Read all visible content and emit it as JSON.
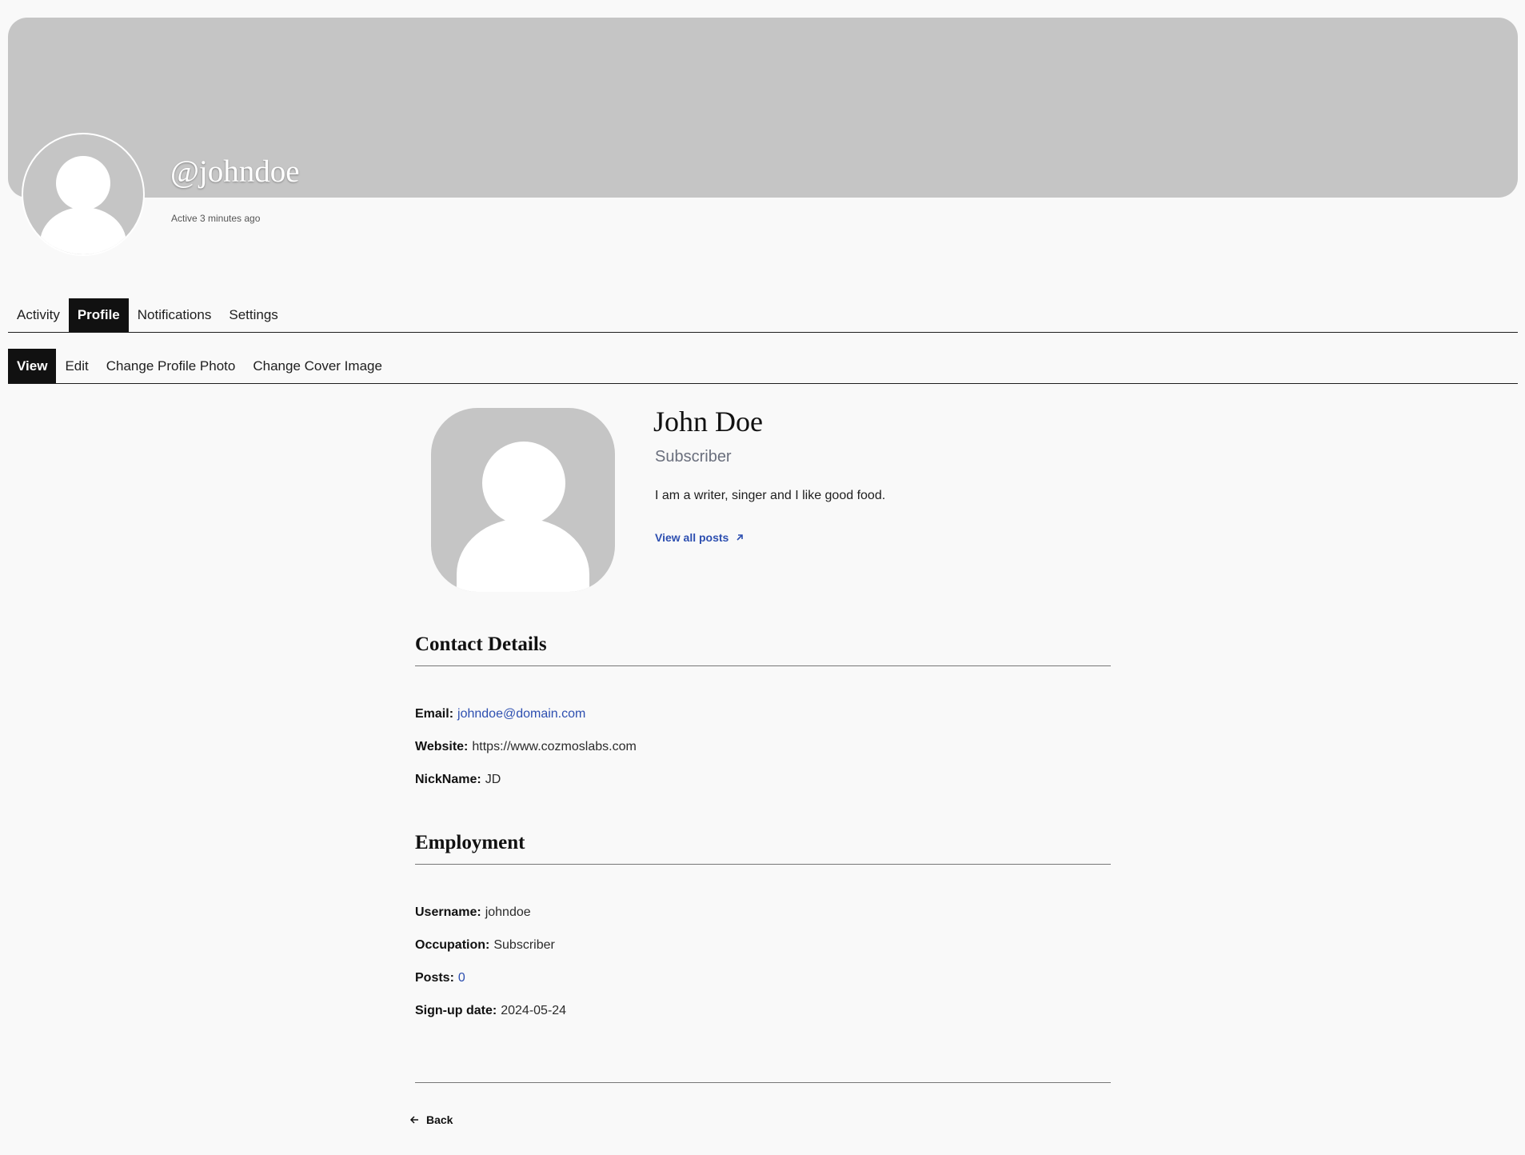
{
  "header": {
    "username": "@johndoe",
    "active_status": "Active 3 minutes ago"
  },
  "tabs": [
    {
      "label": "Activity",
      "active": false
    },
    {
      "label": "Profile",
      "active": true
    },
    {
      "label": "Notifications",
      "active": false
    },
    {
      "label": "Settings",
      "active": false
    }
  ],
  "subtabs": [
    {
      "label": "View",
      "active": true
    },
    {
      "label": "Edit",
      "active": false
    },
    {
      "label": "Change Profile Photo",
      "active": false
    },
    {
      "label": "Change Cover Image",
      "active": false
    }
  ],
  "profile": {
    "display_name": "John Doe",
    "role": "Subscriber",
    "bio": "I am a writer, singer and I like good food.",
    "view_posts_label": "View all posts"
  },
  "contact": {
    "title": "Contact Details",
    "email_label": "Email:",
    "email_value": "johndoe@domain.com",
    "website_label": "Website:",
    "website_value": "https://www.cozmoslabs.com",
    "nickname_label": "NickName:",
    "nickname_value": "JD"
  },
  "employment": {
    "title": "Employment",
    "username_label": "Username:",
    "username_value": "johndoe",
    "occupation_label": "Occupation:",
    "occupation_value": "Subscriber",
    "posts_label": "Posts:",
    "posts_value": "0",
    "signup_label": "Sign-up date:",
    "signup_value": "2024-05-24"
  },
  "footer": {
    "back_label": "Back"
  },
  "icons": {
    "view_posts": "arrow-up-right-icon",
    "back": "arrow-left-icon"
  },
  "colors": {
    "link": "#2d4fb0",
    "active_tab": "#111111",
    "cover": "#c5c5c5"
  }
}
